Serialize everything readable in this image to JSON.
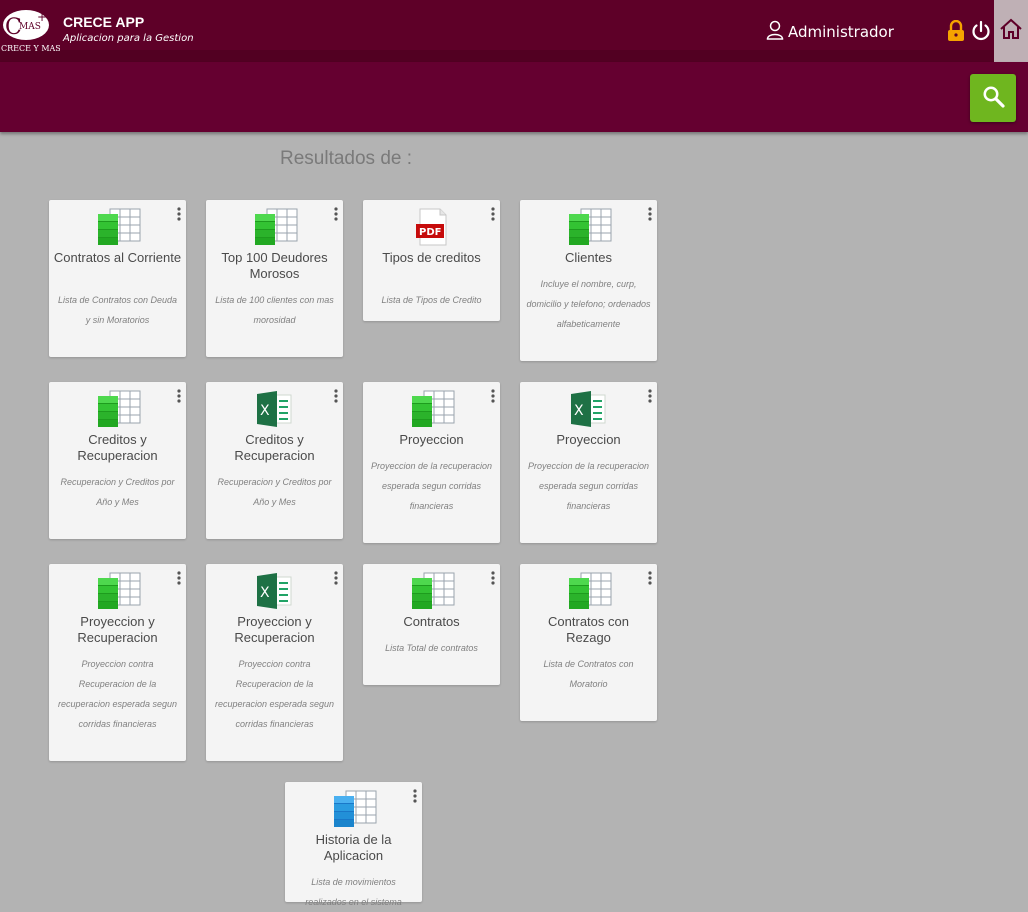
{
  "header": {
    "logo_text": "C MAS + CRECE Y MAS",
    "app_title": "CRECE APP",
    "app_subtitle": "Aplicacion para la Gestion",
    "user_label": "Administrador"
  },
  "main": {
    "results_label": "Resultados de :"
  },
  "cards": [
    {
      "icon": "spreadsheet-green-icon",
      "title": "Contratos al Corriente",
      "desc": "Lista de Contratos con Deuda y sin Moratorios"
    },
    {
      "icon": "spreadsheet-green-icon",
      "title": "Top 100 Deudores Morosos",
      "desc": "Lista de 100 clientes con mas morosidad"
    },
    {
      "icon": "pdf-icon",
      "title": "Tipos de creditos",
      "desc": "Lista de Tipos de Credito"
    },
    {
      "icon": "spreadsheet-green-icon",
      "title": "Clientes",
      "desc": "Incluye el nombre, curp, domicilio y telefono; ordenados alfabeticamente"
    },
    {
      "icon": "spreadsheet-green-icon",
      "title": "Creditos y Recuperacion",
      "desc": "Recuperacion y Creditos por Año y Mes"
    },
    {
      "icon": "excel-icon",
      "title": "Creditos y Recuperacion",
      "desc": "Recuperacion y Creditos por Año y Mes"
    },
    {
      "icon": "spreadsheet-green-icon",
      "title": "Proyeccion",
      "desc": "Proyeccion de la recuperacion esperada segun corridas financieras"
    },
    {
      "icon": "excel-icon",
      "title": "Proyeccion",
      "desc": "Proyeccion de la recuperacion esperada segun corridas financieras"
    },
    {
      "icon": "spreadsheet-green-icon",
      "title": "Proyeccion y Recuperacion",
      "desc": "Proyeccion contra Recuperacion de la recuperacion esperada segun corridas financieras"
    },
    {
      "icon": "excel-icon",
      "title": "Proyeccion y Recuperacion",
      "desc": "Proyeccion contra Recuperacion de la recuperacion esperada segun corridas financieras"
    },
    {
      "icon": "spreadsheet-green-icon",
      "title": "Contratos",
      "desc": "Lista Total de contratos"
    },
    {
      "icon": "spreadsheet-green-icon",
      "title": "Contratos con Rezago",
      "desc": "Lista de Contratos con Moratorio"
    },
    {
      "icon": "spreadsheet-blue-icon",
      "title": "Historia de la Aplicacion",
      "desc": "Lista de movimientos realizados en el sistema"
    }
  ],
  "colors": {
    "header_bg": "#5e0028",
    "search_button": "#6fb61f",
    "page_bg": "#b3b3b3"
  }
}
